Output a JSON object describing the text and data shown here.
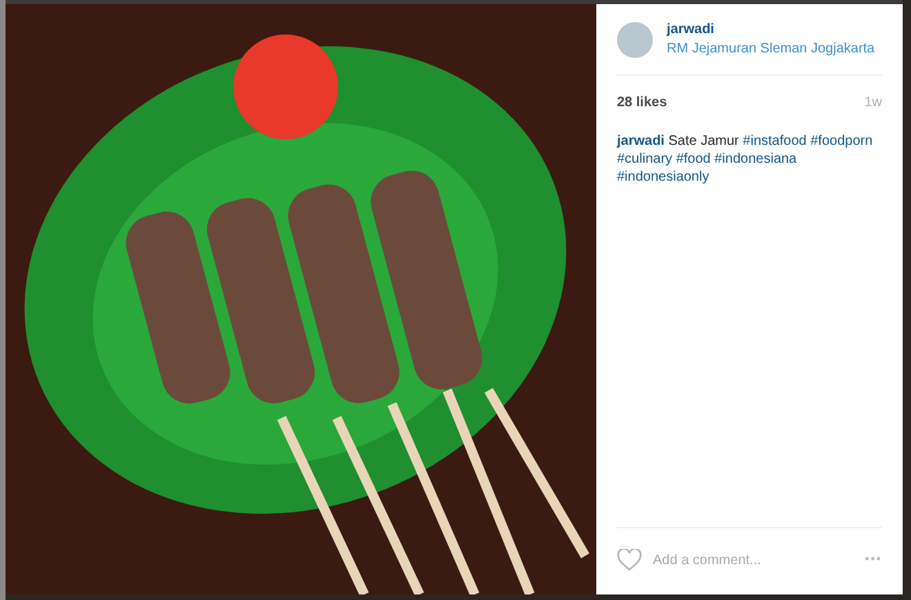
{
  "post": {
    "username": "jarwadi",
    "location": "RM Jejamuran Sleman Jogjakarta",
    "likes": "28 likes",
    "time": "1w",
    "caption": {
      "username": "jarwadi",
      "text": "Sate Jamur",
      "hashtags": [
        "#instafood",
        "#foodporn",
        "#culinary",
        "#food",
        "#indonesiana",
        "#indonesiaonly"
      ]
    },
    "comment_field": {
      "placeholder": "Add a comment..."
    },
    "more_button": "•••",
    "liked": false
  }
}
